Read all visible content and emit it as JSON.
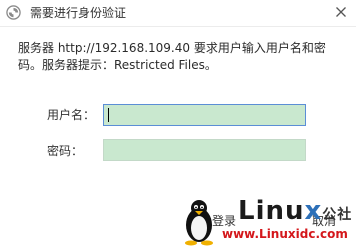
{
  "window": {
    "title": "需要进行身份验证",
    "icon": "app-swirl-icon",
    "close_icon": "close-icon"
  },
  "message": "服务器 http://192.168.109.40 要求用户输入用户名和密码。服务器提示：Restricted Files。",
  "form": {
    "username_label": "用户名：",
    "username_value": "",
    "password_label": "密码：",
    "password_value": ""
  },
  "buttons": {
    "login_label": "登录",
    "cancel_label": "取消"
  },
  "watermark": {
    "logo_text_1": "Linu",
    "logo_text_2": "x",
    "logo_text_3": "公社",
    "url": "www.Linuxidc.com"
  },
  "colors": {
    "input_bg": "#c9e8cf",
    "focus_border": "#5b8ed6",
    "watermark_red": "#d4171b",
    "watermark_blue": "#2d70b8"
  }
}
